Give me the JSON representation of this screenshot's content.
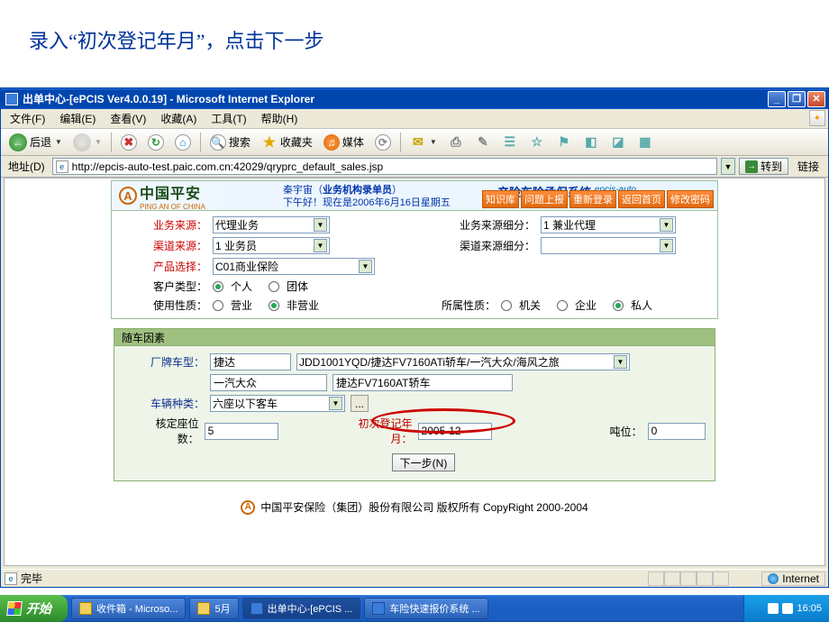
{
  "slide_caption": "录入“初次登记年月”，点击下一步",
  "win_title": "出单中心-[ePCIS Ver4.0.0.19] - Microsoft Internet Explorer",
  "menu": {
    "file": "文件(F)",
    "edit": "编辑(E)",
    "view": "查看(V)",
    "fav": "收藏(A)",
    "tools": "工具(T)",
    "help": "帮助(H)"
  },
  "tb": {
    "back": "后退",
    "search": "搜索",
    "favorites": "收藏夹",
    "media": "媒体"
  },
  "addr": {
    "label": "地址(D)",
    "url": "http://epcis-auto-test.paic.com.cn:42029/qryprc_default_sales.jsp",
    "go": "转到",
    "links": "链接"
  },
  "banner": {
    "brand_cn": "中国平安",
    "brand_sub": "PING AN OF CHINA",
    "mid_line1_a": "秦宇宙（",
    "mid_line1_b": "业务机构录单员",
    "mid_line1_c": "）",
    "mid_line2": "下午好！现在是2006年6月16日星期五",
    "sys_title": "产险车险承保系统",
    "sys_sub": "epcis-auto",
    "nlinks": [
      "知识库",
      "问题上报",
      "重新登录",
      "返回首页",
      "修改密码"
    ]
  },
  "form1": {
    "r1l": "业务来源：",
    "r1v": "代理业务",
    "r1l2": "业务来源细分：",
    "r1v2": "1 兼业代理",
    "r2l": "渠道来源：",
    "r2v": "1 业务员",
    "r2l2": "渠道来源细分：",
    "r3l": "产品选择：",
    "r3v": "C01商业保险",
    "r4l": "客户类型：",
    "r4a": "个人",
    "r4b": "团体",
    "r5l": "使用性质：",
    "r5a": "营业",
    "r5b": "非营业",
    "r5l2": "所属性质：",
    "r5c": "机关",
    "r5d": "企业",
    "r5e": "私人"
  },
  "veh": {
    "head": "随车因素",
    "r1l": "厂牌车型：",
    "r1a": "捷达",
    "r1b": "JDD1001YQD/捷达FV7160ATi轿车/一汽大众/海风之旅",
    "r2a": "一汽大众",
    "r2b": "捷达FV7160AT轿车",
    "r3l": "车辆种类：",
    "r3v": "六座以下客车",
    "r3btn": "...",
    "r4l": "核定座位数：",
    "r4v": "5",
    "r4l2": "初次登记年月：",
    "r4v2": "2005-12",
    "r4l3": "吨位：",
    "r4v3": "0",
    "next": "下一步(N)"
  },
  "copyright": "中国平安保险（集团）股份有限公司 版权所有 CopyRight 2000-2004",
  "status": {
    "done": "完毕",
    "zone": "Internet"
  },
  "taskbar": {
    "start": "开始",
    "t1": "收件箱 - Microso...",
    "t2": "5月",
    "t3": "出单中心-[ePCIS ...",
    "t4": "车险快速报价系统 ...",
    "clock": "16:05"
  }
}
